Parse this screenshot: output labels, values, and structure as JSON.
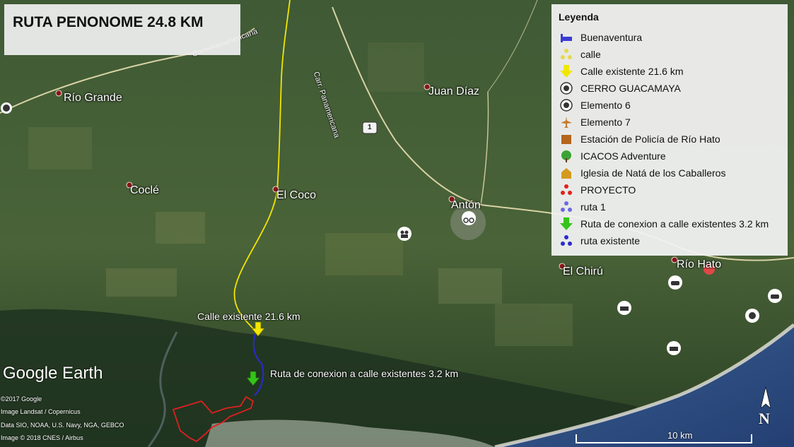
{
  "title": "RUTA PENONOME 24.8 KM",
  "legend": {
    "title": "Leyenda",
    "items": [
      {
        "label": "Buenaventura",
        "icon": "bed-icon",
        "color": "#3b3bd6"
      },
      {
        "label": "calle",
        "icon": "yellow-dots-icon",
        "color": "#e8d84a"
      },
      {
        "label": "Calle existente 21.6 km",
        "icon": "yellow-arrow-icon",
        "color": "#f2e600"
      },
      {
        "label": "CERRO GUACAMAYA",
        "icon": "hiker-circle-icon",
        "color": "#333333"
      },
      {
        "label": "Elemento 6",
        "icon": "circle-badge-icon",
        "color": "#333333"
      },
      {
        "label": "Elemento 7",
        "icon": "airplane-icon",
        "color": "#c77a2e"
      },
      {
        "label": "Estación de Policía de Río Hato",
        "icon": "police-icon",
        "color": "#b5651d"
      },
      {
        "label": "ICACOS Adventure",
        "icon": "tree-icon",
        "color": "#3aa335"
      },
      {
        "label": "Iglesia de Natá de los Caballeros",
        "icon": "church-icon",
        "color": "#d49a1e"
      },
      {
        "label": "PROYECTO",
        "icon": "red-dots-icon",
        "color": "#e02020"
      },
      {
        "label": "ruta 1",
        "icon": "blue-dots-icon",
        "color": "#6a6ae0"
      },
      {
        "label": "Ruta de conexion a calle existentes 3.2 km",
        "icon": "green-arrow-icon",
        "color": "#35c41a"
      },
      {
        "label": "ruta existente",
        "icon": "darkblue-dots-icon",
        "color": "#2a2ad0"
      }
    ]
  },
  "places": {
    "rio_grande": "Río Grande",
    "cocle": "Coclé",
    "el_coco": "El Coco",
    "juan_diaz": "Juan Díaz",
    "anton": "Antón",
    "el_chiru": "El Chirú",
    "rio_hato": "Río Hato"
  },
  "road_label": "Carr. Panamericana",
  "road_label_top": "Carr. Panamericana",
  "highway_shield": "1",
  "annotations": {
    "calle_existente": "Calle existente 21.6 km",
    "ruta_conexion": "Ruta de conexion a calle existentes  3.2 km"
  },
  "brand": "Google Earth",
  "credits": [
    "©2017 Google",
    "Image Landsat / Copernicus",
    "Data SIO, NOAA, U.S. Navy, NGA, GEBCO",
    "Image © 2018 CNES / Airbus"
  ],
  "scale_label": "10 km",
  "compass": "N",
  "colors": {
    "route_yellow": "#f2e600",
    "route_blue": "#2a2ad0",
    "project_red": "#e02020",
    "sea": "#2d4f8a"
  }
}
